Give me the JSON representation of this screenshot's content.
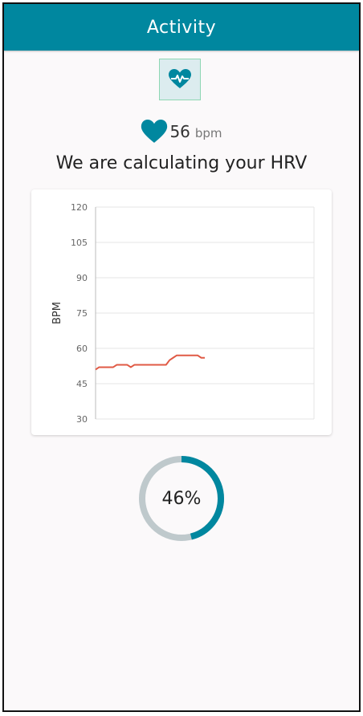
{
  "header": {
    "title": "Activity"
  },
  "icons": {
    "activity": "heart-pulse-icon",
    "heart": "heart-icon"
  },
  "heart_rate": {
    "value": "56",
    "unit": "bpm"
  },
  "status": {
    "message": "We are calculating your HRV"
  },
  "chart_data": {
    "type": "line",
    "ylabel": "BPM",
    "xlabel": "",
    "ylim": [
      30,
      120
    ],
    "yticks": [
      120,
      105,
      90,
      75,
      60,
      45,
      30
    ],
    "grid": true,
    "series": [
      {
        "color": "#e05a45",
        "values": [
          51,
          52,
          52,
          52,
          52,
          52,
          53,
          53,
          53,
          53,
          52,
          53,
          53,
          53,
          53,
          53,
          53,
          53,
          53,
          53,
          53,
          55,
          56,
          57,
          57,
          57,
          57,
          57,
          57,
          57,
          56,
          56
        ]
      }
    ],
    "x_range": [
      0,
      62
    ]
  },
  "progress": {
    "percent": 46,
    "label": "46%",
    "track_color": "#bfc9cc",
    "fill_color": "#00879f"
  },
  "colors": {
    "primary": "#00879f",
    "background": "#fbf9fa"
  }
}
